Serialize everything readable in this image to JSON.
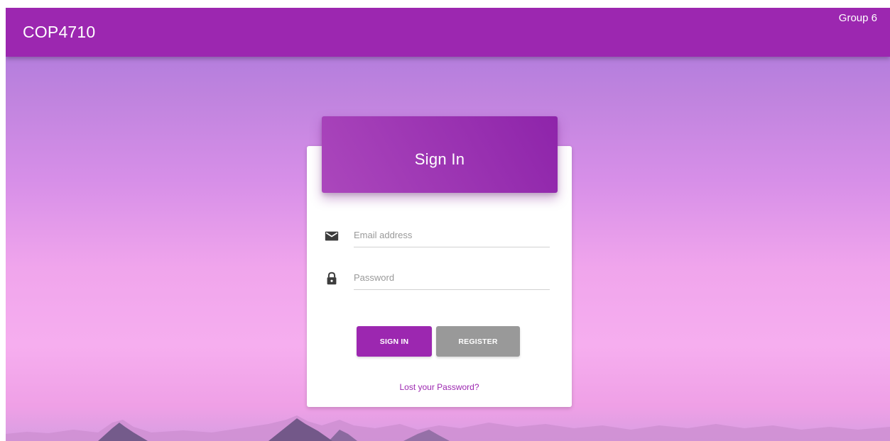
{
  "navbar": {
    "brand": "COP4710",
    "group_link": "Group 6",
    "color": "#9c27b0"
  },
  "login": {
    "title": "Sign In",
    "email": {
      "icon": "envelope-icon",
      "placeholder": "Email address",
      "value": ""
    },
    "password": {
      "icon": "lock-icon",
      "placeholder": "Password",
      "value": ""
    },
    "signin_label": "SIGN IN",
    "register_label": "REGISTER",
    "lost_password_link": "Lost your Password?"
  },
  "colors": {
    "accent": "#9c27b0",
    "secondary_button": "#999999",
    "background_top": "#a777dc",
    "background_bottom": "#f6aeef"
  }
}
